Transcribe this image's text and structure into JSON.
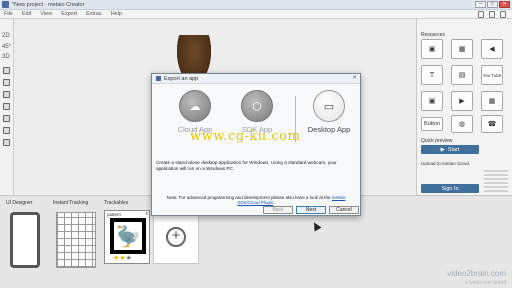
{
  "window": {
    "title": "*New project - metaio Creator",
    "controls": [
      "–",
      "□",
      "✕"
    ]
  },
  "menu": [
    "File",
    "Edit",
    "View",
    "Export",
    "Extras",
    "Help"
  ],
  "left_toolbar": {
    "labels": [
      "2D",
      "45°",
      "3D"
    ]
  },
  "resources": {
    "title": "Resources",
    "tiles": [
      {
        "icon": "image-icon",
        "glyph": "▣"
      },
      {
        "icon": "picture-icon",
        "glyph": "▦"
      },
      {
        "icon": "sound-icon",
        "glyph": "◀"
      },
      {
        "icon": "text-icon",
        "glyph": "T"
      },
      {
        "icon": "image-preview-icon",
        "glyph": "▤"
      },
      {
        "icon": "youtube-icon",
        "glyph": "You Tube"
      },
      {
        "icon": "media-icon",
        "glyph": "▣"
      },
      {
        "icon": "video-icon",
        "glyph": "▶"
      },
      {
        "icon": "film-icon",
        "glyph": "▦"
      },
      {
        "label": "Button"
      },
      {
        "icon": "globe-icon",
        "glyph": "◍"
      },
      {
        "icon": "phone-icon",
        "glyph": "☎"
      },
      {
        "icon": "tool-icon",
        "glyph": "▦"
      },
      {
        "icon": "email-icon",
        "glyph": "✉"
      },
      {
        "icon": "pdf-icon",
        "glyph": "▤"
      }
    ]
  },
  "quick_preview": {
    "title": "Quick preview",
    "start_label": "Start"
  },
  "cloud": {
    "upload_label": "Upload to metaio Cloud",
    "signin_label": "Sign In"
  },
  "bottom": {
    "ui_designer": "UI Designer",
    "instant_tracking": "Instant Tracking",
    "trackables": "Trackables",
    "trackable_item": "pattern",
    "trackable_close": "x",
    "rating": 2,
    "rating_max": 3
  },
  "dialog": {
    "title": "Export an app",
    "close": "✕",
    "options": [
      {
        "label": "Cloud App",
        "icon": "cloud-icon",
        "glyph": "☁",
        "selected": false
      },
      {
        "label": "SDK App",
        "icon": "sdk-icon",
        "glyph": "⬡",
        "selected": false
      },
      {
        "label": "Desktop App",
        "icon": "monitor-icon",
        "glyph": "▭",
        "selected": true
      }
    ],
    "description": "Create a stand-alone desktop application for Windows. Using a standard webcam, your application will run on a Windows PC.",
    "note_prefix": "Note: For advanced programming and development please also have a look at the ",
    "note_link": "metaio SDK/Cloud Plugin",
    "note_suffix": ".",
    "buttons": {
      "back": "Back",
      "next": "Next",
      "cancel": "Cancel"
    }
  },
  "overlay_watermark": "www.cg-ku.com",
  "corner_watermark": "video2brain.com",
  "corner_watermark_sub": "a lynda.com brand"
}
